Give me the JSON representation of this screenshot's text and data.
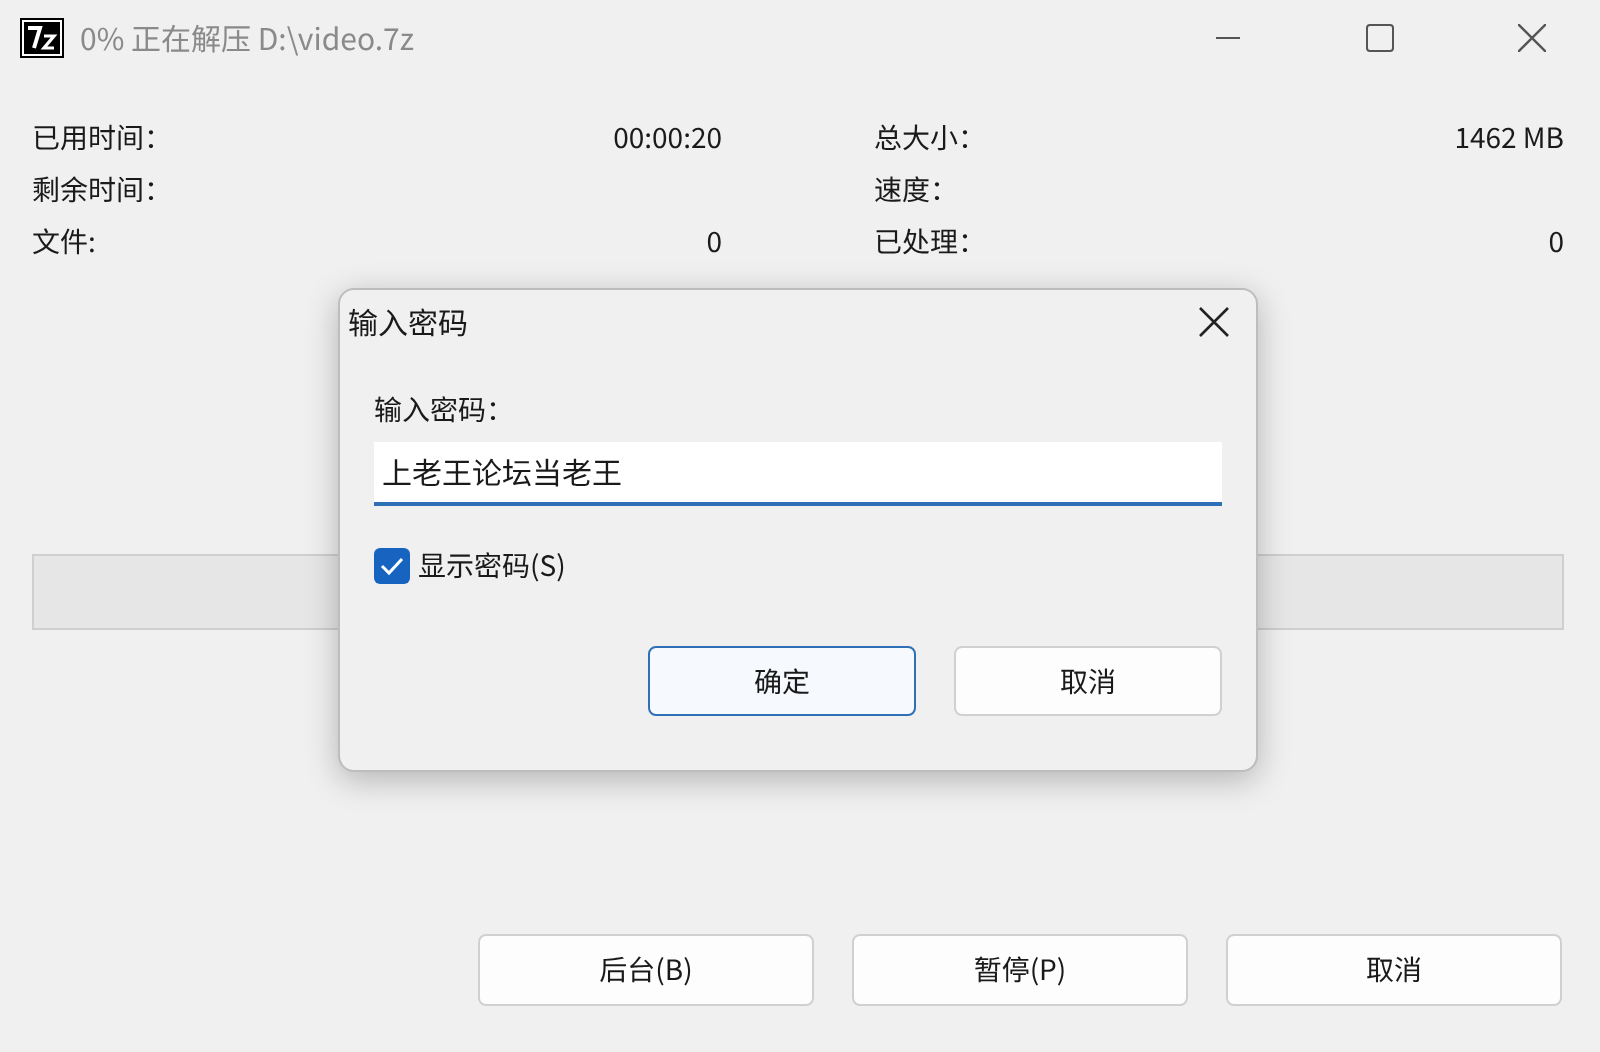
{
  "window": {
    "title": "0% 正在解压 D:\\video.7z"
  },
  "stats_left": [
    {
      "label": "已用时间：",
      "value": "00:00:20"
    },
    {
      "label": "剩余时间："
    },
    {
      "label": "文件:",
      "value": "0"
    }
  ],
  "stats_right": [
    {
      "label": "总大小：",
      "value": "1462 MB"
    },
    {
      "label": "速度："
    },
    {
      "label": "已处理：",
      "value": "0"
    }
  ],
  "progress": {
    "level": 0
  },
  "buttons": [
    "后台(B)",
    "暂停(P)",
    "取消"
  ],
  "dialog": {
    "title": "输入密码",
    "field_label": "输入密码：",
    "value": "上老王论坛当老王",
    "show_password": {
      "label": "显示密码(S)",
      "checked": true
    },
    "buttons": [
      {
        "label": "确定",
        "default": true
      },
      {
        "label": "取消",
        "default": false
      }
    ]
  }
}
